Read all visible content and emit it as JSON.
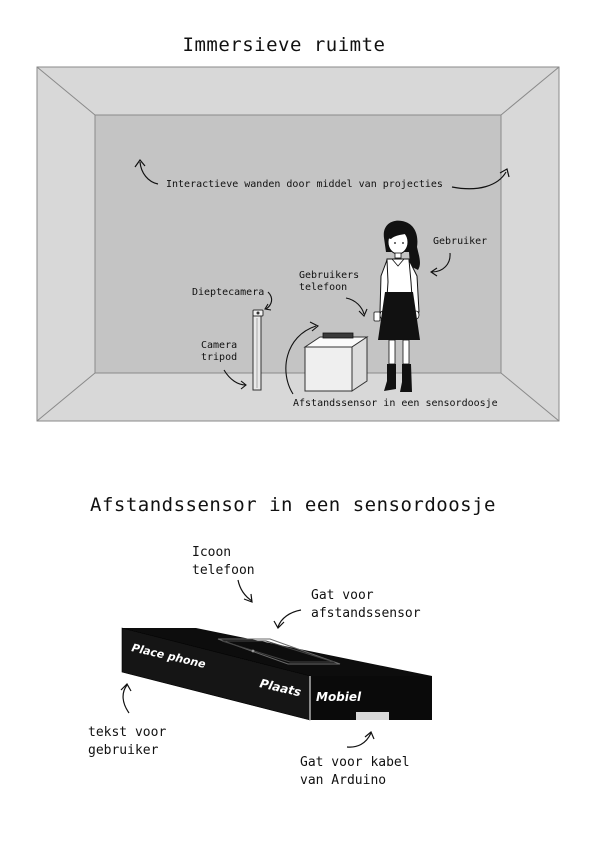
{
  "section_room": {
    "title": "Immersieve ruimte",
    "labels": {
      "walls": "Interactieve wanden door middel van projecties",
      "user": "Gebruiker",
      "user_phone": "Gebruikers\ntelefoon",
      "depth_camera": "Dieptecamera",
      "camera_tripod": "Camera\ntripod",
      "sensor": "Afstandssensor in een sensordoosje"
    }
  },
  "section_box": {
    "title": "Afstandssensor in een sensordoosje",
    "labels": {
      "phone_icon": "Icoon\ntelefoon",
      "sensor_hole": "Gat voor\nafstandssensor",
      "user_text": "tekst voor\ngebruiker",
      "cable_hole": "Gat voor kabel\nvan Arduino"
    },
    "box_text": {
      "place_phone": "Place phone",
      "plaats": "Plaats",
      "mobiel": "Mobiel"
    }
  },
  "colors": {
    "outer_wall": "#d8d8d8",
    "back_wall": "#c4c4c4",
    "box_black": "#0d0d0d"
  }
}
